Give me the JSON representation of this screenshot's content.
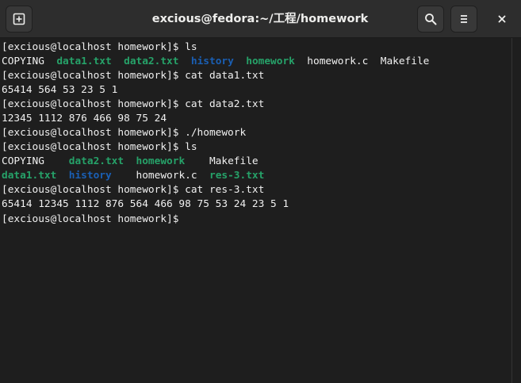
{
  "window": {
    "title": "excious@fedora:~/工程/homework"
  },
  "headerbar": {
    "new_tab_icon": "new-tab-icon",
    "search_icon": "search-icon",
    "menu_icon": "hamburger-menu-icon",
    "close_icon": "close-icon"
  },
  "colors": {
    "background": "#1e1e1e",
    "headerbar": "#2d2d2d",
    "text": "#f0f0f0",
    "executable": "#26a269",
    "directory": "#1a5fb4"
  },
  "terminal": {
    "lines": [
      [
        {
          "text": "[excious@localhost homework]$ ls",
          "style": "plain"
        }
      ],
      [
        {
          "text": "COPYING  ",
          "style": "plain"
        },
        {
          "text": "data1.txt",
          "style": "exe"
        },
        {
          "text": "  ",
          "style": "plain"
        },
        {
          "text": "data2.txt",
          "style": "exe"
        },
        {
          "text": "  ",
          "style": "plain"
        },
        {
          "text": "history",
          "style": "dir"
        },
        {
          "text": "  ",
          "style": "plain"
        },
        {
          "text": "homework",
          "style": "exe"
        },
        {
          "text": "  homework.c  Makefile",
          "style": "plain"
        }
      ],
      [
        {
          "text": "[excious@localhost homework]$ cat data1.txt",
          "style": "plain"
        }
      ],
      [
        {
          "text": "65414 564 53 23 5 1",
          "style": "plain"
        }
      ],
      [
        {
          "text": "[excious@localhost homework]$ cat data2.txt",
          "style": "plain"
        }
      ],
      [
        {
          "text": "12345 1112 876 466 98 75 24",
          "style": "plain"
        }
      ],
      [
        {
          "text": "[excious@localhost homework]$ ./homework",
          "style": "plain"
        }
      ],
      [
        {
          "text": "[excious@localhost homework]$ ls",
          "style": "plain"
        }
      ],
      [
        {
          "text": "COPYING    ",
          "style": "plain"
        },
        {
          "text": "data2.txt",
          "style": "exe"
        },
        {
          "text": "  ",
          "style": "plain"
        },
        {
          "text": "homework",
          "style": "exe"
        },
        {
          "text": "    Makefile",
          "style": "plain"
        }
      ],
      [
        {
          "text": "data1.txt",
          "style": "exe"
        },
        {
          "text": "  ",
          "style": "plain"
        },
        {
          "text": "history",
          "style": "dir"
        },
        {
          "text": "    homework.c  ",
          "style": "plain"
        },
        {
          "text": "res-3.txt",
          "style": "exe"
        }
      ],
      [
        {
          "text": "[excious@localhost homework]$ cat res-3.txt",
          "style": "plain"
        }
      ],
      [
        {
          "text": "65414 12345 1112 876 564 466 98 75 53 24 23 5 1",
          "style": "plain"
        }
      ],
      [
        {
          "text": "[excious@localhost homework]$",
          "style": "plain"
        }
      ]
    ]
  }
}
